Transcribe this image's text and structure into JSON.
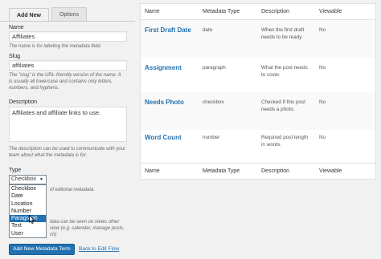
{
  "tabs": [
    {
      "label": "Add New",
      "active": true
    },
    {
      "label": "Options",
      "active": false
    }
  ],
  "form": {
    "name_label": "Name",
    "name_value": "Affiliates",
    "name_help": "The name is for labeling the metadata field.",
    "slug_label": "Slug",
    "slug_value": "affiliates",
    "slug_help_1": "The \"slug\" is the URL-friendly version of the name. It",
    "slug_help_2": "is usually all lowercase and contains only letters,",
    "slug_help_3": "numbers, and hyphens.",
    "desc_label": "Description",
    "desc_value": "Affiliates and affiliate links to use.",
    "desc_help_1": "The description can be used to communicate with your",
    "desc_help_2": "team about what the metadata is for.",
    "type_label": "Type",
    "type_selected": "Checkbox",
    "type_help_partial": "of editorial metadata.",
    "view_help_1": "data can be seen on views other",
    "view_help_2": "view (e.g. calendar, manage posts,",
    "view_help_3": "ch)",
    "type_options": [
      {
        "label": "Checkbox",
        "highlighted": false
      },
      {
        "label": "Date",
        "highlighted": false
      },
      {
        "label": "Location",
        "highlighted": false
      },
      {
        "label": "Number",
        "highlighted": false
      },
      {
        "label": "Paragraph",
        "highlighted": true
      },
      {
        "label": "Text",
        "highlighted": false
      },
      {
        "label": "User",
        "highlighted": false
      }
    ],
    "submit_label": "Add New Metadata Term",
    "back_link": "Back to Edit Flow"
  },
  "table": {
    "headers": [
      "Name",
      "Metadata Type",
      "Description",
      "Viewable"
    ],
    "rows": [
      {
        "name": "First Draft Date",
        "type": "date",
        "desc_1": "When the first draft",
        "desc_2": "needs to be ready.",
        "viewable": "No"
      },
      {
        "name": "Assignment",
        "type": "paragraph",
        "desc_1": "What the post needs",
        "desc_2": "to cover.",
        "viewable": "No"
      },
      {
        "name": "Needs Photo",
        "type": "checkbox",
        "desc_1": "Checked if this post",
        "desc_2": "needs a photo.",
        "viewable": "No"
      },
      {
        "name": "Word Count",
        "type": "number",
        "desc_1": "Required post length",
        "desc_2": "in words.",
        "viewable": "No"
      }
    ]
  },
  "colors": {
    "accent": "#2271b1",
    "background": "#f1f1f1",
    "selection": "#2271b1"
  }
}
